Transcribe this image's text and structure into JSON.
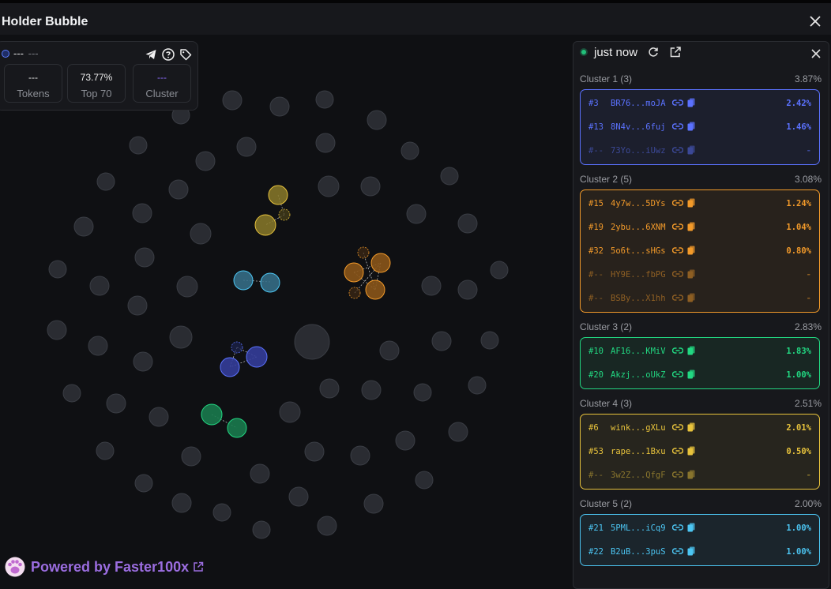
{
  "header": {
    "title": "Holder Bubble"
  },
  "info": {
    "name": "---",
    "name_sub": "---",
    "stats": [
      {
        "value": "---",
        "label": "Tokens"
      },
      {
        "value": "73.77%",
        "label": "Top 70"
      },
      {
        "value": "---",
        "label": "Cluster"
      }
    ]
  },
  "powered": {
    "text": "Powered by Faster100x"
  },
  "panel": {
    "status": "just now",
    "clusters": [
      {
        "title": "Cluster 1 (3)",
        "pct": "3.87%",
        "color": "#5b72ff",
        "rows": [
          {
            "rank": "#3",
            "addr": "BR76...moJA",
            "pct": "2.42%"
          },
          {
            "rank": "#13",
            "addr": "8N4v...6fuj",
            "pct": "1.46%"
          },
          {
            "rank": "#--",
            "addr": "73Yo...iUwz",
            "pct": "-",
            "dim": true
          }
        ]
      },
      {
        "title": "Cluster 2 (5)",
        "pct": "3.08%",
        "color": "#f29a2a",
        "rows": [
          {
            "rank": "#15",
            "addr": "4y7w...5DYs",
            "pct": "1.24%"
          },
          {
            "rank": "#19",
            "addr": "2ybu...6XNM",
            "pct": "1.04%"
          },
          {
            "rank": "#32",
            "addr": "5o6t...sHGs",
            "pct": "0.80%"
          },
          {
            "rank": "#--",
            "addr": "HY9E...fbPG",
            "pct": "-",
            "dim": true
          },
          {
            "rank": "#--",
            "addr": "BSBy...X1hh",
            "pct": "-",
            "dim": true
          }
        ]
      },
      {
        "title": "Cluster 3 (2)",
        "pct": "2.83%",
        "color": "#22d882",
        "rows": [
          {
            "rank": "#10",
            "addr": "AF16...KMiV",
            "pct": "1.83%"
          },
          {
            "rank": "#20",
            "addr": "Akzj...oUkZ",
            "pct": "1.00%"
          }
        ]
      },
      {
        "title": "Cluster 4 (3)",
        "pct": "2.51%",
        "color": "#e8c33c",
        "rows": [
          {
            "rank": "#6",
            "addr": "wink...gXLu",
            "pct": "2.01%"
          },
          {
            "rank": "#53",
            "addr": "rape...1Bxu",
            "pct": "0.50%"
          },
          {
            "rank": "#--",
            "addr": "3w2Z...QfgF",
            "pct": "-",
            "dim": true
          }
        ]
      },
      {
        "title": "Cluster 5 (2)",
        "pct": "2.00%",
        "color": "#4cc5f2",
        "rows": [
          {
            "rank": "#21",
            "addr": "5PML...iCq9",
            "pct": "1.00%"
          },
          {
            "rank": "#22",
            "addr": "B2uB...3puS",
            "pct": "1.00%"
          }
        ]
      }
    ]
  },
  "icons": [
    "telegram-icon",
    "help-icon",
    "tag-icon",
    "refresh-icon",
    "external-link-icon",
    "close-icon",
    "link-icon",
    "copy-icon",
    "paw-logo-icon"
  ]
}
